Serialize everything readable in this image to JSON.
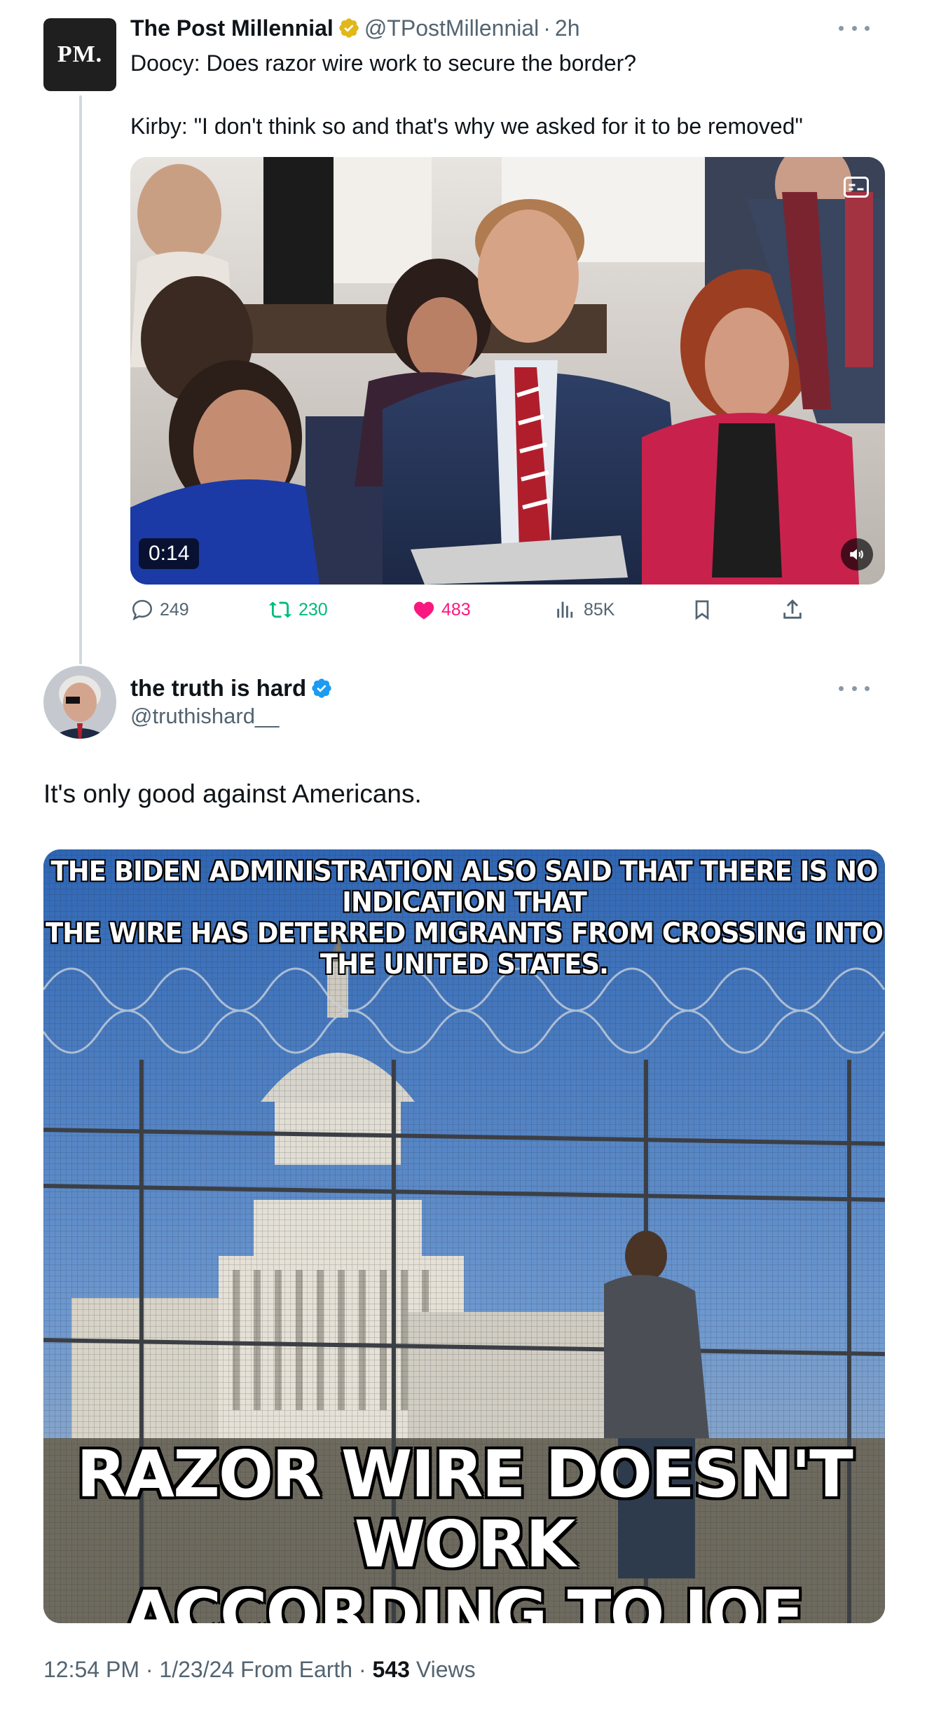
{
  "quoted_tweet": {
    "avatar_text": "PM.",
    "name": "The Post Millennial",
    "handle": "@TPostMillennial",
    "separator": "·",
    "time": "2h",
    "text_line1": "Doocy: Does razor wire work to secure the border?",
    "text_line2": "Kirby: \"I don't think so and that's why we asked for it to be removed\"",
    "video_duration": "0:14",
    "replies": "249",
    "reposts": "230",
    "likes": "483",
    "views": "85K"
  },
  "main_tweet": {
    "name": "the truth is hard",
    "handle": "@truthishard__",
    "text": "It's only good against Americans.",
    "meme_top_line1": "THE BIDEN ADMINISTRATION ALSO SAID THAT THERE IS NO INDICATION THAT",
    "meme_top_line2": "THE WIRE HAS DETERRED MIGRANTS FROM CROSSING INTO THE UNITED STATES.",
    "meme_bottom_line1": "RAZOR WIRE DOESN'T WORK",
    "meme_bottom_line2": "ACCORDING TO JOE BIDEN",
    "time": "12:54 PM",
    "date": "1/23/24",
    "source": "From Earth",
    "views_count": "543",
    "views_label": "Views"
  },
  "colors": {
    "text_primary": "#0f1419",
    "text_secondary": "#536471",
    "accent_green": "#00ba7c",
    "accent_pink": "#f91880",
    "accent_blue": "#1d9bf0",
    "gold_badge": "#e2b719"
  },
  "icons": [
    "more-icon",
    "gold-verified-badge",
    "blue-verified-badge",
    "reply-icon",
    "repost-icon",
    "like-icon",
    "views-icon",
    "bookmark-icon",
    "share-icon",
    "mute-icon"
  ]
}
